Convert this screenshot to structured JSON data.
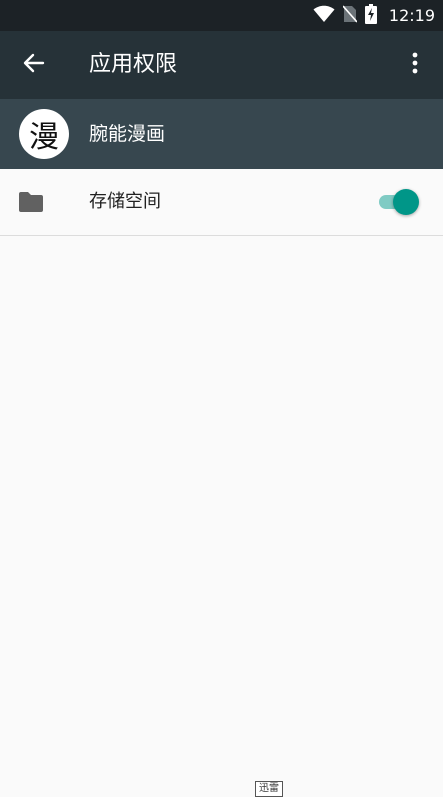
{
  "status_bar": {
    "time": "12:19",
    "icons": [
      "wifi-icon",
      "no-sim-icon",
      "battery-charging-icon"
    ]
  },
  "app_bar": {
    "title": "应用权限",
    "back_icon": "arrow-back-icon",
    "overflow_icon": "more-vert-icon"
  },
  "app_header": {
    "avatar_char": "漫",
    "app_name": "腕能漫画"
  },
  "permissions": [
    {
      "icon": "folder-icon",
      "label": "存储空间",
      "enabled": true
    }
  ],
  "watermark": {
    "text": "迅雷"
  },
  "colors": {
    "status_bar": "#1c2226",
    "app_bar": "#263238",
    "app_header": "#37474f",
    "accent": "#009688",
    "accent_track": "#80cbc4",
    "background": "#fafafa"
  }
}
